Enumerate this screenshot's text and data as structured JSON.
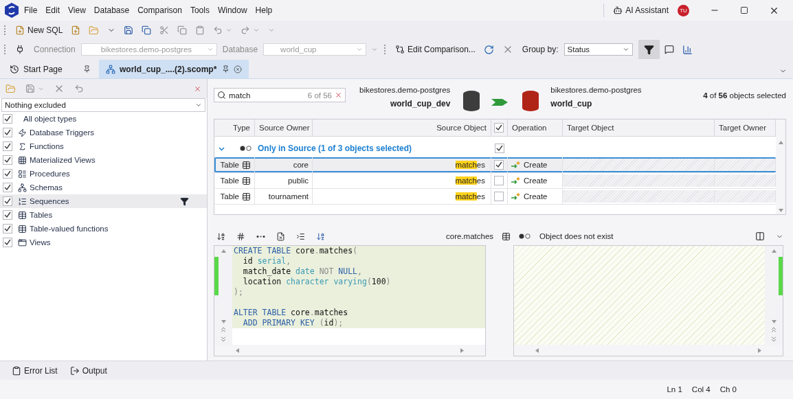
{
  "menu": [
    "File",
    "Edit",
    "View",
    "Database",
    "Comparison",
    "Tools",
    "Window",
    "Help"
  ],
  "ai_assistant": {
    "label": "AI Assistant",
    "avatar": "TU"
  },
  "toolbar": {
    "new_sql": "New SQL"
  },
  "connection_bar": {
    "connection_label": "Connection",
    "connection_value": "bikestores.demo-postgres",
    "database_label": "Database",
    "database_value": "world_cup",
    "edit_comparison": "Edit Comparison...",
    "group_by_label": "Group by:",
    "group_by_value": "Status",
    "filter_on": true
  },
  "tabs": [
    {
      "label": "Start Page",
      "selected": false
    },
    {
      "label": "world_cup_....(2).scomp*",
      "selected": true
    }
  ],
  "filter_panel": {
    "preset": "Nothing excluded",
    "items": [
      {
        "label": "All object types",
        "checked": true,
        "selected": false
      },
      {
        "label": "Database Triggers",
        "checked": true,
        "selected": false
      },
      {
        "label": "Functions",
        "checked": true,
        "selected": false
      },
      {
        "label": "Materialized Views",
        "checked": true,
        "selected": false
      },
      {
        "label": "Procedures",
        "checked": true,
        "selected": false
      },
      {
        "label": "Schemas",
        "checked": true,
        "selected": false
      },
      {
        "label": "Sequences",
        "checked": true,
        "selected": true
      },
      {
        "label": "Tables",
        "checked": true,
        "selected": false
      },
      {
        "label": "Table-valued functions",
        "checked": true,
        "selected": false
      },
      {
        "label": "Views",
        "checked": true,
        "selected": false
      }
    ]
  },
  "search": {
    "value": "match",
    "count": "6 of 56"
  },
  "source": {
    "server": "bikestores.demo-postgres",
    "database": "world_cup_dev"
  },
  "target": {
    "server": "bikestores.demo-postgres",
    "database": "world_cup"
  },
  "selection_summary": "**4** of **56** objects selected",
  "grid": {
    "columns": [
      "Type",
      "Source Owner",
      "Source Object",
      "Operation",
      "Target Object",
      "Target Owner"
    ],
    "header_checked": true,
    "group": {
      "label": "Only in Source (1 of 3 objects selected)",
      "expanded": true,
      "checked": true
    },
    "rows": [
      {
        "type": "Table",
        "owner": "core",
        "object_match": "match",
        "object_rest": "es",
        "checked": true,
        "operation": "Create",
        "selected": true
      },
      {
        "type": "Table",
        "owner": "public",
        "object_match": "match",
        "object_rest": "es",
        "checked": false,
        "operation": "Create",
        "selected": false
      },
      {
        "type": "Table",
        "owner": "tournament",
        "object_match": "match",
        "object_rest": "es",
        "checked": false,
        "operation": "Create",
        "selected": false
      }
    ]
  },
  "details": {
    "object": "core.matches",
    "status": "Object does not exist"
  },
  "sql": [
    {
      "tokens": [
        {
          "kind": "keyword",
          "t": "CREATE TABLE"
        },
        {
          "kind": "plain",
          "t": " core"
        },
        {
          "kind": "muted",
          "t": "."
        },
        {
          "kind": "plain",
          "t": "matches"
        },
        {
          "kind": "muted",
          "t": "("
        }
      ]
    },
    {
      "tokens": [
        {
          "kind": "plain",
          "t": "  id "
        },
        {
          "kind": "type",
          "t": "serial"
        },
        {
          "kind": "muted",
          "t": ","
        }
      ]
    },
    {
      "tokens": [
        {
          "kind": "plain",
          "t": "  match_date "
        },
        {
          "kind": "type",
          "t": "date"
        },
        {
          "kind": "muted",
          "t": " NOT"
        },
        {
          "kind": "keyword",
          "t": " NULL"
        },
        {
          "kind": "muted",
          "t": ","
        }
      ]
    },
    {
      "tokens": [
        {
          "kind": "plain",
          "t": "  location "
        },
        {
          "kind": "type",
          "t": "character varying"
        },
        {
          "kind": "muted",
          "t": "("
        },
        {
          "kind": "plain",
          "t": "100"
        },
        {
          "kind": "muted",
          "t": ")"
        }
      ]
    },
    {
      "tokens": [
        {
          "kind": "muted",
          "t": ");"
        }
      ]
    },
    {
      "space_before": true,
      "tokens": [
        {
          "kind": "keyword",
          "t": "ALTER TABLE"
        },
        {
          "kind": "plain",
          "t": " core"
        },
        {
          "kind": "muted",
          "t": "."
        },
        {
          "kind": "plain",
          "t": "matches"
        }
      ]
    },
    {
      "tokens": [
        {
          "kind": "keyword",
          "t": "  ADD PRIMARY KEY"
        },
        {
          "kind": "muted",
          "t": " ("
        },
        {
          "kind": "plain",
          "t": "id"
        },
        {
          "kind": "muted",
          "t": ");"
        }
      ]
    }
  ],
  "bottom_tabs": [
    "Error List",
    "Output"
  ],
  "status": [
    "Ln 1",
    "Col 4",
    "Ch 0"
  ]
}
